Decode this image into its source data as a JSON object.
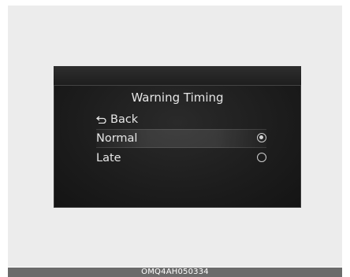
{
  "screen": {
    "title": "Warning Timing",
    "back_label": "Back",
    "options": [
      {
        "label": "Normal",
        "selected": true
      },
      {
        "label": "Late",
        "selected": false
      }
    ]
  },
  "caption": "OMQ4AH050334",
  "colors": {
    "screen_bg": "#1c1c1c",
    "text": "#e6e6e6",
    "caption_bar": "#6b6b6b"
  },
  "icons": {
    "back": "back-arrow-icon",
    "radio_selected": "radio-selected-icon",
    "radio_unselected": "radio-unselected-icon"
  }
}
